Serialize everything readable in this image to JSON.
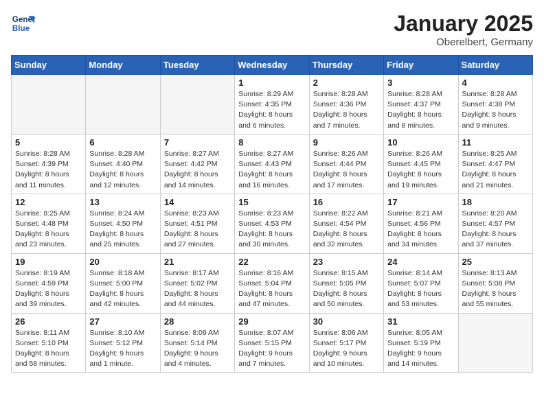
{
  "header": {
    "logo_line1": "General",
    "logo_line2": "Blue",
    "month_title": "January 2025",
    "location": "Oberelbert, Germany"
  },
  "weekdays": [
    "Sunday",
    "Monday",
    "Tuesday",
    "Wednesday",
    "Thursday",
    "Friday",
    "Saturday"
  ],
  "weeks": [
    [
      {
        "day": "",
        "info": ""
      },
      {
        "day": "",
        "info": ""
      },
      {
        "day": "",
        "info": ""
      },
      {
        "day": "1",
        "info": "Sunrise: 8:29 AM\nSunset: 4:35 PM\nDaylight: 8 hours\nand 6 minutes."
      },
      {
        "day": "2",
        "info": "Sunrise: 8:28 AM\nSunset: 4:36 PM\nDaylight: 8 hours\nand 7 minutes."
      },
      {
        "day": "3",
        "info": "Sunrise: 8:28 AM\nSunset: 4:37 PM\nDaylight: 8 hours\nand 8 minutes."
      },
      {
        "day": "4",
        "info": "Sunrise: 8:28 AM\nSunset: 4:38 PM\nDaylight: 8 hours\nand 9 minutes."
      }
    ],
    [
      {
        "day": "5",
        "info": "Sunrise: 8:28 AM\nSunset: 4:39 PM\nDaylight: 8 hours\nand 11 minutes."
      },
      {
        "day": "6",
        "info": "Sunrise: 8:28 AM\nSunset: 4:40 PM\nDaylight: 8 hours\nand 12 minutes."
      },
      {
        "day": "7",
        "info": "Sunrise: 8:27 AM\nSunset: 4:42 PM\nDaylight: 8 hours\nand 14 minutes."
      },
      {
        "day": "8",
        "info": "Sunrise: 8:27 AM\nSunset: 4:43 PM\nDaylight: 8 hours\nand 16 minutes."
      },
      {
        "day": "9",
        "info": "Sunrise: 8:26 AM\nSunset: 4:44 PM\nDaylight: 8 hours\nand 17 minutes."
      },
      {
        "day": "10",
        "info": "Sunrise: 8:26 AM\nSunset: 4:45 PM\nDaylight: 8 hours\nand 19 minutes."
      },
      {
        "day": "11",
        "info": "Sunrise: 8:25 AM\nSunset: 4:47 PM\nDaylight: 8 hours\nand 21 minutes."
      }
    ],
    [
      {
        "day": "12",
        "info": "Sunrise: 8:25 AM\nSunset: 4:48 PM\nDaylight: 8 hours\nand 23 minutes."
      },
      {
        "day": "13",
        "info": "Sunrise: 8:24 AM\nSunset: 4:50 PM\nDaylight: 8 hours\nand 25 minutes."
      },
      {
        "day": "14",
        "info": "Sunrise: 8:23 AM\nSunset: 4:51 PM\nDaylight: 8 hours\nand 27 minutes."
      },
      {
        "day": "15",
        "info": "Sunrise: 8:23 AM\nSunset: 4:53 PM\nDaylight: 8 hours\nand 30 minutes."
      },
      {
        "day": "16",
        "info": "Sunrise: 8:22 AM\nSunset: 4:54 PM\nDaylight: 8 hours\nand 32 minutes."
      },
      {
        "day": "17",
        "info": "Sunrise: 8:21 AM\nSunset: 4:56 PM\nDaylight: 8 hours\nand 34 minutes."
      },
      {
        "day": "18",
        "info": "Sunrise: 8:20 AM\nSunset: 4:57 PM\nDaylight: 8 hours\nand 37 minutes."
      }
    ],
    [
      {
        "day": "19",
        "info": "Sunrise: 8:19 AM\nSunset: 4:59 PM\nDaylight: 8 hours\nand 39 minutes."
      },
      {
        "day": "20",
        "info": "Sunrise: 8:18 AM\nSunset: 5:00 PM\nDaylight: 8 hours\nand 42 minutes."
      },
      {
        "day": "21",
        "info": "Sunrise: 8:17 AM\nSunset: 5:02 PM\nDaylight: 8 hours\nand 44 minutes."
      },
      {
        "day": "22",
        "info": "Sunrise: 8:16 AM\nSunset: 5:04 PM\nDaylight: 8 hours\nand 47 minutes."
      },
      {
        "day": "23",
        "info": "Sunrise: 8:15 AM\nSunset: 5:05 PM\nDaylight: 8 hours\nand 50 minutes."
      },
      {
        "day": "24",
        "info": "Sunrise: 8:14 AM\nSunset: 5:07 PM\nDaylight: 8 hours\nand 53 minutes."
      },
      {
        "day": "25",
        "info": "Sunrise: 8:13 AM\nSunset: 5:08 PM\nDaylight: 8 hours\nand 55 minutes."
      }
    ],
    [
      {
        "day": "26",
        "info": "Sunrise: 8:11 AM\nSunset: 5:10 PM\nDaylight: 8 hours\nand 58 minutes."
      },
      {
        "day": "27",
        "info": "Sunrise: 8:10 AM\nSunset: 5:12 PM\nDaylight: 9 hours\nand 1 minute."
      },
      {
        "day": "28",
        "info": "Sunrise: 8:09 AM\nSunset: 5:14 PM\nDaylight: 9 hours\nand 4 minutes."
      },
      {
        "day": "29",
        "info": "Sunrise: 8:07 AM\nSunset: 5:15 PM\nDaylight: 9 hours\nand 7 minutes."
      },
      {
        "day": "30",
        "info": "Sunrise: 8:06 AM\nSunset: 5:17 PM\nDaylight: 9 hours\nand 10 minutes."
      },
      {
        "day": "31",
        "info": "Sunrise: 8:05 AM\nSunset: 5:19 PM\nDaylight: 9 hours\nand 14 minutes."
      },
      {
        "day": "",
        "info": ""
      }
    ]
  ]
}
